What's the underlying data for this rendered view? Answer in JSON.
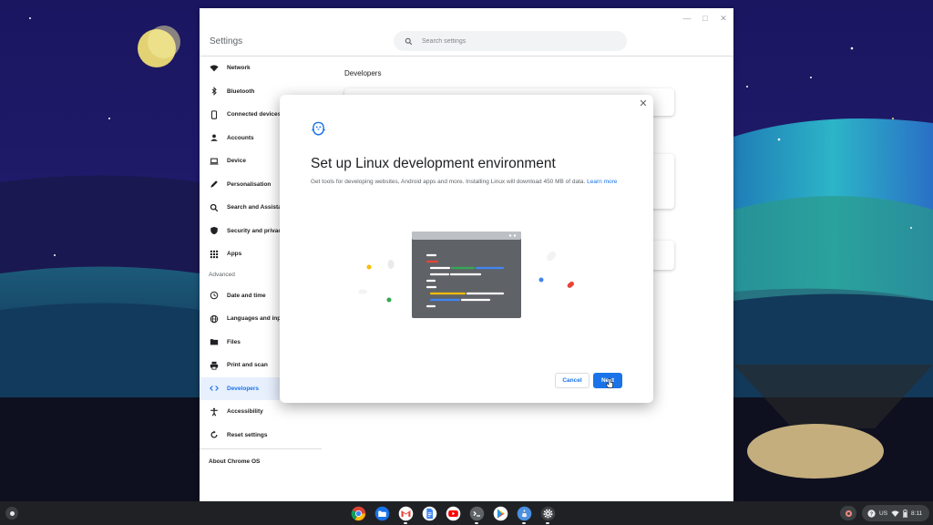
{
  "window": {
    "app_title": "Settings",
    "controls": [
      "minimize-icon",
      "maximize-icon",
      "close-icon"
    ],
    "search_placeholder": "Search settings"
  },
  "sidebar": {
    "items": [
      {
        "label": "Network",
        "icon": "wifi-icon"
      },
      {
        "label": "Bluetooth",
        "icon": "bluetooth-icon"
      },
      {
        "label": "Connected devices",
        "icon": "phone-icon"
      },
      {
        "label": "Accounts",
        "icon": "person-icon"
      },
      {
        "label": "Device",
        "icon": "laptop-icon"
      },
      {
        "label": "Personalisation",
        "icon": "pencil-icon"
      },
      {
        "label": "Search and Assistant",
        "icon": "search-icon"
      },
      {
        "label": "Security and privacy",
        "icon": "shield-icon"
      },
      {
        "label": "Apps",
        "icon": "grid-icon"
      }
    ],
    "advanced_label": "Advanced",
    "advanced_items": [
      {
        "label": "Date and time",
        "icon": "clock-icon"
      },
      {
        "label": "Languages and inputs",
        "icon": "globe-icon"
      },
      {
        "label": "Files",
        "icon": "folder-icon"
      },
      {
        "label": "Print and scan",
        "icon": "printer-icon"
      },
      {
        "label": "Developers",
        "icon": "code-icon",
        "active": true
      },
      {
        "label": "Accessibility",
        "icon": "accessibility-icon"
      },
      {
        "label": "Reset settings",
        "icon": "reset-icon"
      }
    ],
    "about_label": "About Chrome OS"
  },
  "content": {
    "section_title": "Developers"
  },
  "dialog": {
    "title": "Set up Linux development environment",
    "description": "Get tools for developing websites, Android apps and more. Installing Linux will download 450 MB of data.",
    "learn_more": "Learn more",
    "cancel_label": "Cancel",
    "next_label": "Next"
  },
  "shelf": {
    "apps": [
      "chrome-icon",
      "files-icon",
      "gmail-icon",
      "docs-icon",
      "youtube-icon",
      "terminal-icon",
      "play-store-icon",
      "linux-penguin-icon",
      "settings-gear-icon"
    ],
    "status": {
      "help_icon": "?",
      "keyboard_layout": "US",
      "time": "8:11"
    }
  },
  "colors": {
    "accent": "#1a73e8",
    "active_nav_bg": "#e8f0fe",
    "shelf_bg": "#202124"
  }
}
